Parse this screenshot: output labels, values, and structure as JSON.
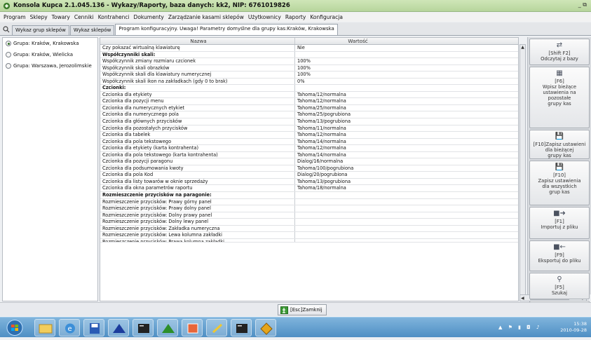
{
  "window": {
    "title": "Konsola Kupca 2.1.045.136 - Wykazy/Raporty,  baza danych: kk2, NIP: 6761019826",
    "title_right": "_ ⧉"
  },
  "menu": [
    "Program",
    "Sklepy",
    "Towary",
    "Cenniki",
    "Kontrahenci",
    "Dokumenty",
    "Zarządzanie kasami sklepów",
    "Użytkownicy",
    "Raporty",
    "Konfiguracja"
  ],
  "tabs": [
    "Wykaz grup sklepów",
    "Wykaz sklepów",
    "Program konfiguracyjny. Uwaga! Parametry domyślne dla grupy kas:Kraków, Krakowska"
  ],
  "groups": [
    {
      "label": "Grupa: Kraków, Krakowska",
      "selected": true
    },
    {
      "label": "Grupa: Kraków, Wielicka",
      "selected": false
    },
    {
      "label": "Grupa: Warszawa, Jerozolimskie",
      "selected": false
    }
  ],
  "grid": {
    "headers": {
      "name": "Nazwa",
      "value": "Wartość"
    },
    "rows": [
      {
        "name": "Czy pokazać wirtualną klawiaturę",
        "value": "Nie"
      },
      {
        "name": "Współczynniki skali:",
        "value": "",
        "section": true
      },
      {
        "name": "Współczynnik zmiany rozmiaru czcionek",
        "value": "100%"
      },
      {
        "name": "Współczynnik skali obrazków",
        "value": "100%"
      },
      {
        "name": "Współczynnik skali dla klawiatury numerycznej",
        "value": "100%"
      },
      {
        "name": "Współczynnik skali ikon na zakładkach (gdy 0 to brak)",
        "value": "0%"
      },
      {
        "name": "Czcionki:",
        "value": "",
        "section": true
      },
      {
        "name": "Czcionka dla etykiety",
        "value": "Tahoma/12/normalna"
      },
      {
        "name": "Czcionka dla pozycji menu",
        "value": "Tahoma/12/normalna"
      },
      {
        "name": "Czcionka dla numerycznych etykiet",
        "value": "Tahoma/25/normalna"
      },
      {
        "name": "Czcionka dla numerycznego pola",
        "value": "Tahoma/25/pogrubiona"
      },
      {
        "name": "Czcionka dla głównych przycisków",
        "value": "Tahoma/13/pogrubiona"
      },
      {
        "name": "Czcionka dla pozostałych przycisków",
        "value": "Tahoma/11/normalna"
      },
      {
        "name": "Czcionka dla tabelek",
        "value": "Tahoma/12/normalna"
      },
      {
        "name": "Czcionka dla pola tekstowego",
        "value": "Tahoma/14/normalna"
      },
      {
        "name": "Czcionka dla etykiety (karta kontrahenta)",
        "value": "Tahoma/12/normalna"
      },
      {
        "name": "Czcionka dla pola tekstowego (karta kontrahenta)",
        "value": "Tahoma/14/normalna"
      },
      {
        "name": "Czcionka dla pozycji paragonu",
        "value": "Dialog/16/normalna"
      },
      {
        "name": "Czcionka dla podsumowania kwoty",
        "value": "Tahoma/100/pogrubiona"
      },
      {
        "name": "Czcionka dla pola Kod",
        "value": "Dialog/20/pogrubiona"
      },
      {
        "name": "Czcionka dla listy towarów w oknie sprzedaży",
        "value": "Tahoma/13/pogrubiona"
      },
      {
        "name": "Czcionka dla okna parametrów raportu",
        "value": "Tahoma/18/normalna"
      },
      {
        "name": "Rozmieszczenie przycisków na paragonie:",
        "value": "",
        "section": true
      },
      {
        "name": "Rozmieszczenie przycisków: Prawy górny panel",
        "value": ""
      },
      {
        "name": "Rozmieszczenie przycisków: Prawy dolny panel",
        "value": ""
      },
      {
        "name": "Rozmieszczenie przycisków: Dolny prawy panel",
        "value": ""
      },
      {
        "name": "Rozmieszczenie przycisków: Dolny lewy panel",
        "value": ""
      },
      {
        "name": "Rozmieszczenie przycisków: Zakładka numeryczna",
        "value": ""
      },
      {
        "name": "Rozmieszczenie przycisków: Lewa kolumna zakładki",
        "value": ""
      },
      {
        "name": "Rozmieszczenie przycisków: Prawa kolumna zakładki",
        "value": ""
      }
    ]
  },
  "actions": [
    {
      "icon": "refresh-icon",
      "glyph": "⇄",
      "label": "[Shift F2]\nOdczytaj z bazy"
    },
    {
      "icon": "copy-icon",
      "glyph": "▦",
      "label": "[F6]\nWpisz bieżące\nustawienia na\npozostałe\ngrupy kas"
    },
    {
      "icon": "save-icon",
      "glyph": "💾",
      "label": "[F10]Zapisz ustawieni\ndla bieżącej\ngrupy kas"
    },
    {
      "icon": "save-all-icon",
      "glyph": "💾",
      "label": "[F10]\nZapisz ustawienia\ndla wszystkich\ngrup kas"
    },
    {
      "icon": "import-icon",
      "glyph": "■➜",
      "label": "[F1]\nImportuj z pliku"
    },
    {
      "icon": "export-icon",
      "glyph": "■←",
      "label": "[F9]\nEksportuj do pliku"
    },
    {
      "icon": "search-icon",
      "glyph": "⚲",
      "label": "[F5]\nSzukaj"
    },
    {
      "icon": "search-next-icon",
      "glyph": "⚲",
      "label": ""
    }
  ],
  "close_button": "[Esc]Zamknij",
  "tray": {
    "time": "15:38",
    "date": "2010-09-28"
  }
}
